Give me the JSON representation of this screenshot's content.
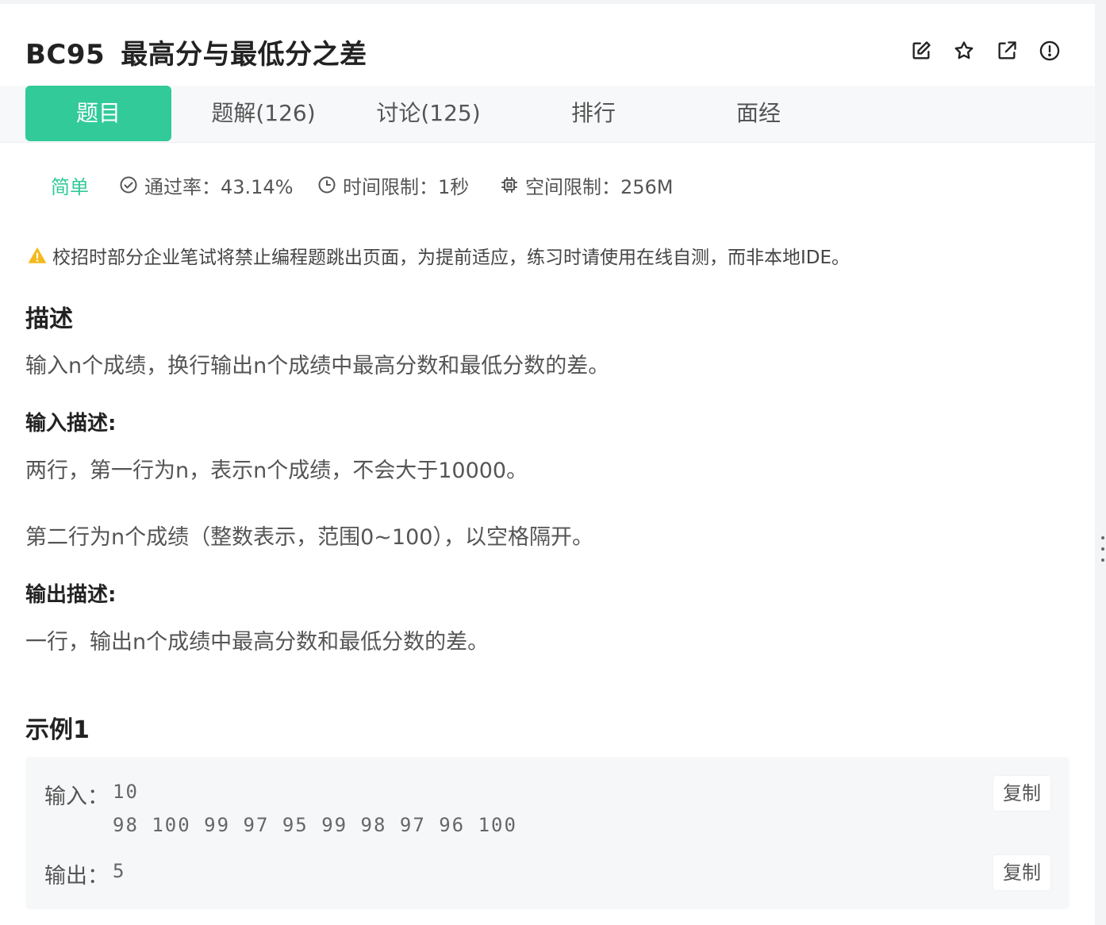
{
  "problem": {
    "code": "BC95",
    "title": "最高分与最低分之差"
  },
  "header_icons": [
    "edit-icon",
    "star-icon",
    "share-icon",
    "report-icon"
  ],
  "tabs": [
    {
      "label": "题目",
      "active": true
    },
    {
      "label": "题解(126)",
      "active": false
    },
    {
      "label": "讨论(125)",
      "active": false
    },
    {
      "label": "排行",
      "active": false
    },
    {
      "label": "面经",
      "active": false
    }
  ],
  "meta": {
    "difficulty": "简单",
    "pass_rate": "通过率：43.14%",
    "time_limit": "时间限制：1秒",
    "memory_limit": "空间限制：256M"
  },
  "warning": "校招时部分企业笔试将禁止编程题跳出页面，为提前适应，练习时请使用在线自测，而非本地IDE。",
  "description": {
    "heading": "描述",
    "text": "输入n个成绩，换行输出n个成绩中最高分数和最低分数的差。"
  },
  "input_desc": {
    "heading": "输入描述:",
    "line1": "两行，第一行为n，表示n个成绩，不会大于10000。",
    "line2": "第二行为n个成绩（整数表示，范围0~100），以空格隔开。"
  },
  "output_desc": {
    "heading": "输出描述:",
    "text": "一行，输出n个成绩中最高分数和最低分数的差。"
  },
  "example": {
    "heading": "示例1",
    "input_label": "输入：",
    "input_line1": "10",
    "input_line2": "98 100 99 97 95 99 98 97 96 100",
    "output_label": "输出：",
    "output_value": "5",
    "copy_label": "复制"
  },
  "colors": {
    "accent": "#32ca99",
    "warning": "#f5b91e"
  }
}
